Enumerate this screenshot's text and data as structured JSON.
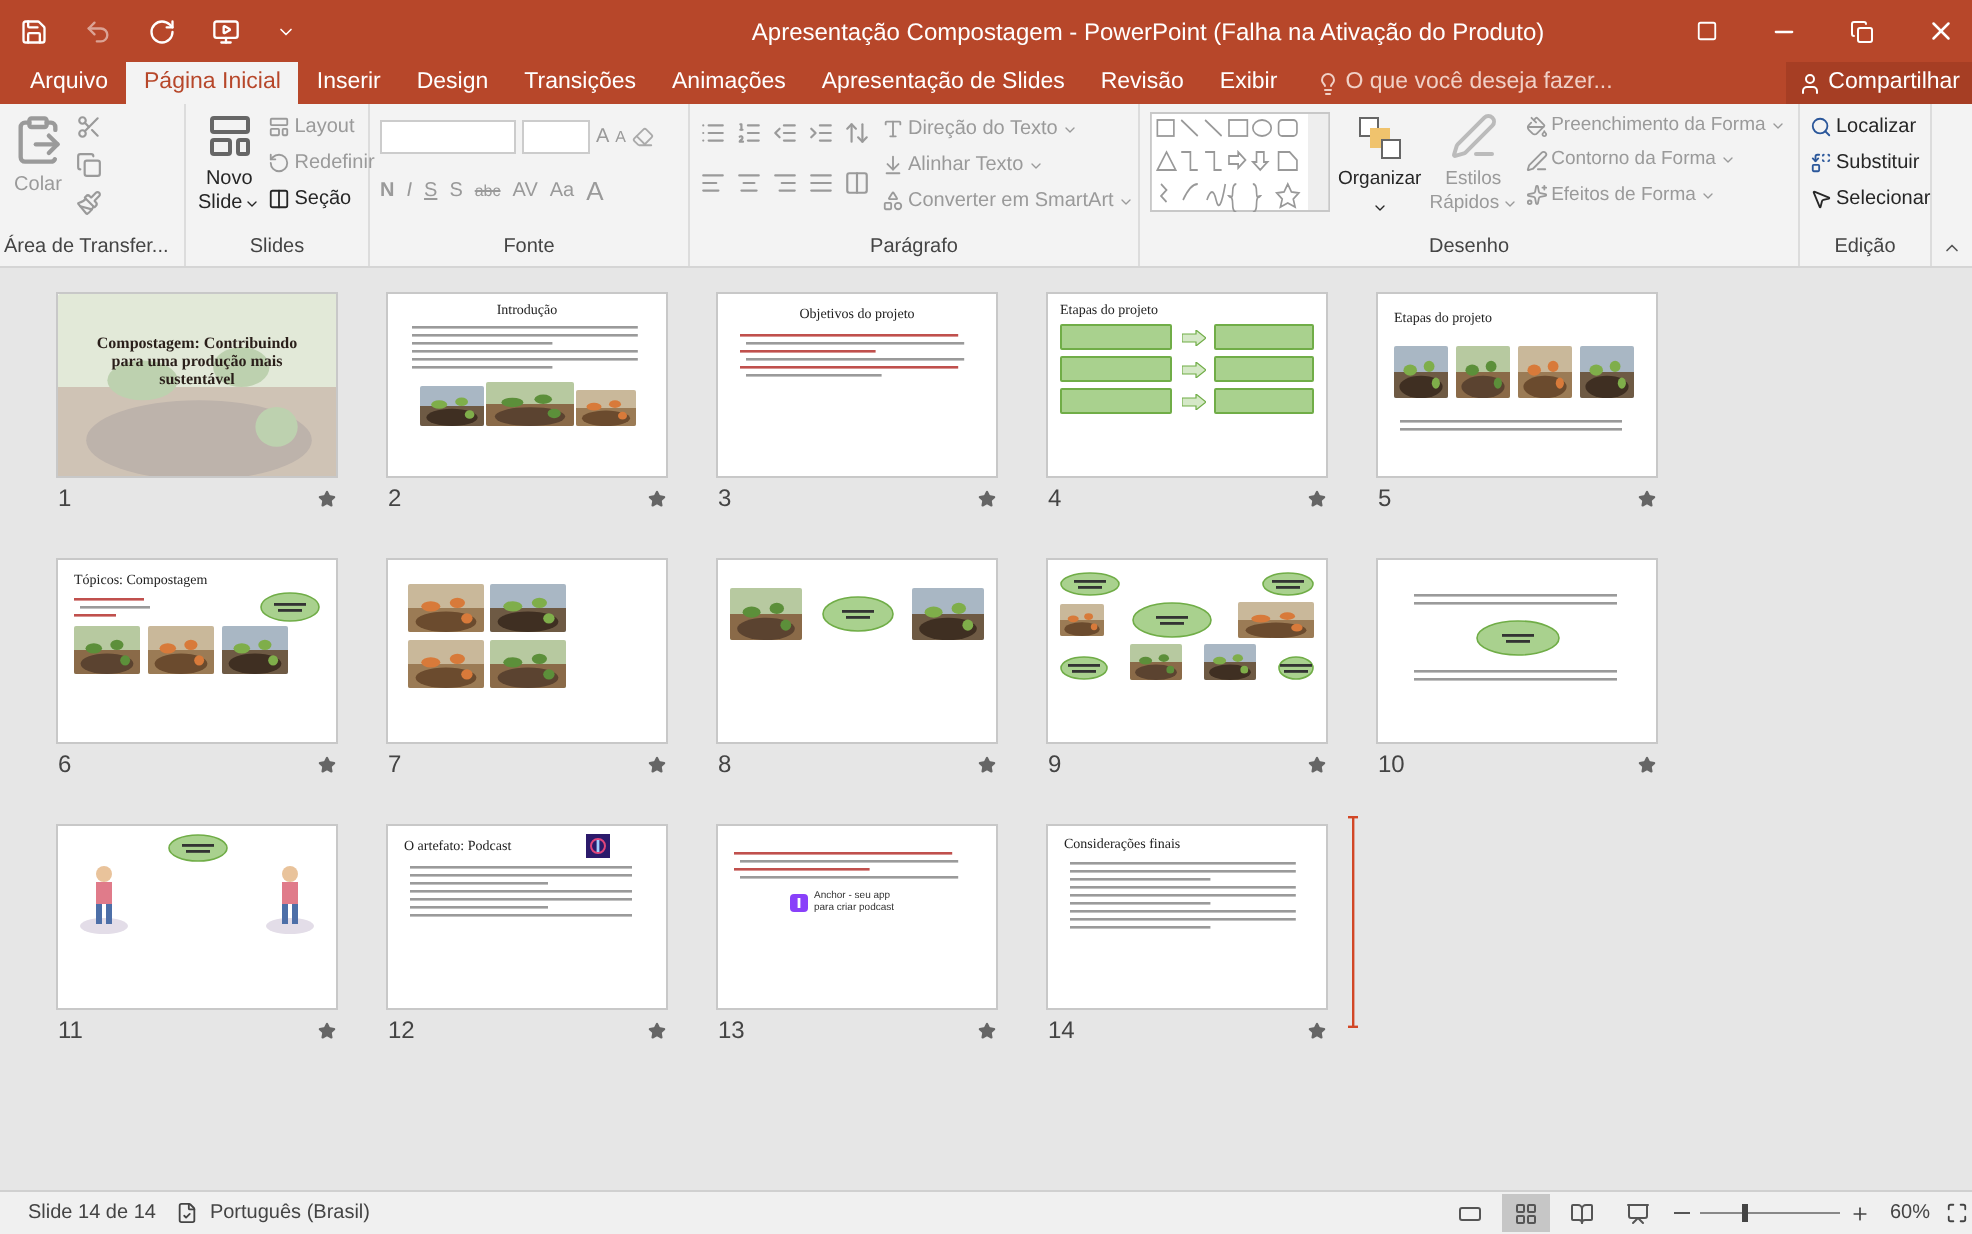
{
  "title_bar": {
    "title": "Apresentação Compostagem - PowerPoint (Falha na Ativação do Produto)"
  },
  "menu_tabs": [
    {
      "label": "Arquivo",
      "selected": false
    },
    {
      "label": "Página Inicial",
      "selected": true
    },
    {
      "label": "Inserir",
      "selected": false
    },
    {
      "label": "Design",
      "selected": false
    },
    {
      "label": "Transições",
      "selected": false
    },
    {
      "label": "Animações",
      "selected": false
    },
    {
      "label": "Apresentação de Slides",
      "selected": false
    },
    {
      "label": "Revisão",
      "selected": false
    },
    {
      "label": "Exibir",
      "selected": false
    }
  ],
  "tell_me": {
    "placeholder": "O que você deseja fazer..."
  },
  "share_button": {
    "label": "Compartilhar"
  },
  "ribbon": {
    "clipboard": {
      "label": "Área de Transfer...",
      "paste": {
        "label": "Colar",
        "disabled": true
      }
    },
    "slides": {
      "label": "Slides",
      "new_slide": {
        "label_line_1": "Novo",
        "label_line_2": "Slide"
      },
      "commands": [
        {
          "label": "Layout",
          "disabled": true
        },
        {
          "label": "Redefinir",
          "disabled": true
        },
        {
          "label": "Seção",
          "disabled": false
        }
      ]
    },
    "font": {
      "label": "Fonte",
      "disabled": true,
      "grow": "A",
      "shrink": "A",
      "format_buttons": [
        "N",
        "I",
        "S",
        "S",
        "abc",
        "AV",
        "Aa"
      ],
      "color_button": "A"
    },
    "paragraph": {
      "label": "Parágrafo",
      "commands": [
        {
          "label": "Direção do Texto",
          "disabled": true
        },
        {
          "label": "Alinhar Texto",
          "disabled": true
        },
        {
          "label": "Converter em SmartArt",
          "disabled": true
        }
      ]
    },
    "drawing": {
      "label": "Desenho",
      "arrange": {
        "label": "Organizar",
        "disabled": false
      },
      "quick_styles": {
        "label_line_1": "Estilos",
        "label_line_2": "Rápidos",
        "disabled": true
      },
      "commands": [
        {
          "label": "Preenchimento da Forma",
          "disabled": true
        },
        {
          "label": "Contorno da Forma",
          "disabled": true
        },
        {
          "label": "Efeitos de Forma",
          "disabled": true
        }
      ]
    },
    "editing": {
      "label": "Edição",
      "commands": [
        {
          "label": "Localizar",
          "disabled": false
        },
        {
          "label": "Substituir",
          "disabled": false
        },
        {
          "label": "Selecionar",
          "disabled": false
        }
      ]
    }
  },
  "slides": [
    {
      "number": "1",
      "kind": "cover",
      "title": "Compostagem: Contribuindo para uma produção mais sustentável"
    },
    {
      "number": "2",
      "kind": "text_photos",
      "title": "Introdução"
    },
    {
      "number": "3",
      "kind": "bullets",
      "title": "Objetivos do projeto"
    },
    {
      "number": "4",
      "kind": "process",
      "title": "Etapas do projeto"
    },
    {
      "number": "5",
      "kind": "photo_row",
      "title": "Etapas do projeto"
    },
    {
      "number": "6",
      "kind": "topics",
      "title": "Tópicos: Compostagem"
    },
    {
      "number": "7",
      "kind": "photo_grid"
    },
    {
      "number": "8",
      "kind": "diagram"
    },
    {
      "number": "9",
      "kind": "mind_map"
    },
    {
      "number": "10",
      "kind": "word_map"
    },
    {
      "number": "11",
      "kind": "cartoon"
    },
    {
      "number": "12",
      "kind": "text_logo",
      "title": "O artefato: Podcast"
    },
    {
      "number": "13",
      "kind": "app",
      "caption": "Anchor - seu app para criar podcast"
    },
    {
      "number": "14",
      "kind": "text",
      "title": "Considerações finais"
    }
  ],
  "status_bar": {
    "slide_info": "Slide 14 de 14",
    "language": "Português (Brasil)",
    "views": [
      {
        "kind": "normal",
        "selected": false
      },
      {
        "kind": "sorter",
        "selected": true
      },
      {
        "kind": "reading",
        "selected": false
      },
      {
        "kind": "slideshow",
        "selected": false
      }
    ],
    "zoom": {
      "level": 0.3,
      "reading": "60%"
    }
  }
}
